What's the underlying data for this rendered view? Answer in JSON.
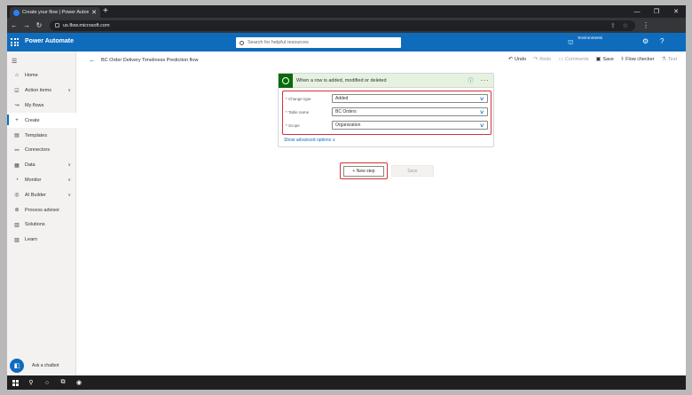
{
  "browser": {
    "tab_title": "Create your flow | Power Automate",
    "url": "us.flow.microsoft.com",
    "new_tab_icon": "plus-icon"
  },
  "app": {
    "name": "Power Automate",
    "search_placeholder": "Search for helpful resources",
    "environments_label": "Environments"
  },
  "sidebar": {
    "items": [
      {
        "label": "Home",
        "icon": "home-icon",
        "chevron": false
      },
      {
        "label": "Action items",
        "icon": "checklist-icon",
        "chevron": true
      },
      {
        "label": "My flows",
        "icon": "flow-icon",
        "chevron": false
      },
      {
        "label": "Create",
        "icon": "plus-icon",
        "chevron": false,
        "active": true
      },
      {
        "label": "Templates",
        "icon": "templates-icon",
        "chevron": false
      },
      {
        "label": "Connectors",
        "icon": "connectors-icon",
        "chevron": false
      },
      {
        "label": "Data",
        "icon": "data-icon",
        "chevron": true
      },
      {
        "label": "Monitor",
        "icon": "monitor-icon",
        "chevron": true
      },
      {
        "label": "AI Builder",
        "icon": "ai-builder-icon",
        "chevron": true
      },
      {
        "label": "Process advisor",
        "icon": "process-advisor-icon",
        "chevron": false
      },
      {
        "label": "Solutions",
        "icon": "solutions-icon",
        "chevron": false
      },
      {
        "label": "Learn",
        "icon": "learn-icon",
        "chevron": false
      }
    ],
    "chatbot_label": "Ask a chatbot"
  },
  "commandbar": {
    "flow_name": "BC Order Delivery Timeliness Prediction flow",
    "undo": "Undo",
    "redo": "Redo",
    "comments": "Comments",
    "save": "Save",
    "flow_checker": "Flow checker",
    "test": "Test"
  },
  "trigger": {
    "title": "When a row is added, modified or deleted",
    "fields": [
      {
        "label": "Change type",
        "value": "Added"
      },
      {
        "label": "Table name",
        "value": "BC Orders"
      },
      {
        "label": "Scope",
        "value": "Organization"
      }
    ],
    "advanced": "Show advanced options"
  },
  "actions": {
    "new_step": "+ New step",
    "save": "Save"
  },
  "colors": {
    "brand": "#0f6cbd",
    "highlight": "#d13438",
    "dataverse": "#0b6a0b"
  }
}
